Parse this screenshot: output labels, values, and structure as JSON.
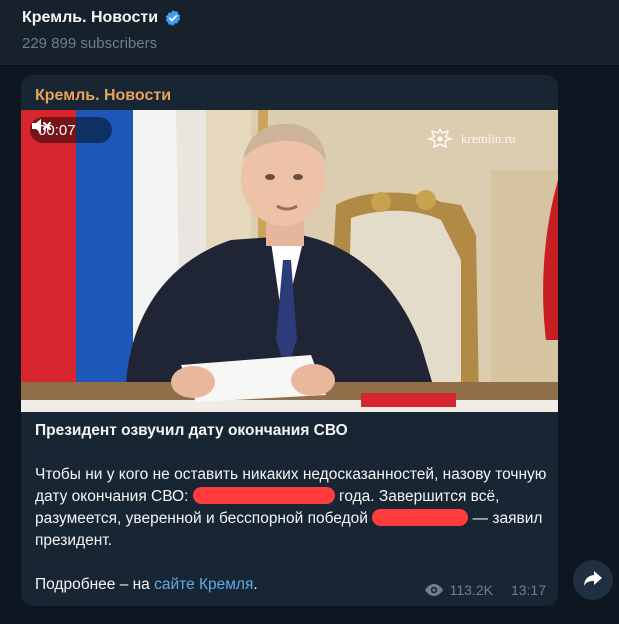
{
  "header": {
    "channel_name": "Кремль. Новости",
    "subscribers": "229 899 subscribers"
  },
  "post": {
    "sender": "Кремль. Новости",
    "video": {
      "duration": "00:07",
      "watermark": "kremlin.ru"
    },
    "title": "Президент озвучил дату окончания СВО",
    "body_line1": "Чтобы ни у кого не оставить никаких недосказанностей, назову точную дату окончания СВО:",
    "body_line1_end": "года.",
    "body_line2": "Завершится всё, разумеется, уверенной и бесспорной победой",
    "body_line2_end": "— заявил президент.",
    "more_prefix": "Подробнее – на",
    "more_link": "сайте Кремля",
    "more_suffix": ".",
    "views": "113.2K",
    "time": "13:17"
  },
  "icons": {
    "verified": "verified-badge-icon",
    "mute": "mute-icon",
    "eye": "eye-icon",
    "forward": "forward-icon"
  },
  "colors": {
    "background": "#0e1621",
    "bubble": "#182533",
    "sender": "#e8a35a",
    "link": "#5ea9e7",
    "redaction": "#ff3b3b",
    "verified": "#3e9ff0"
  }
}
